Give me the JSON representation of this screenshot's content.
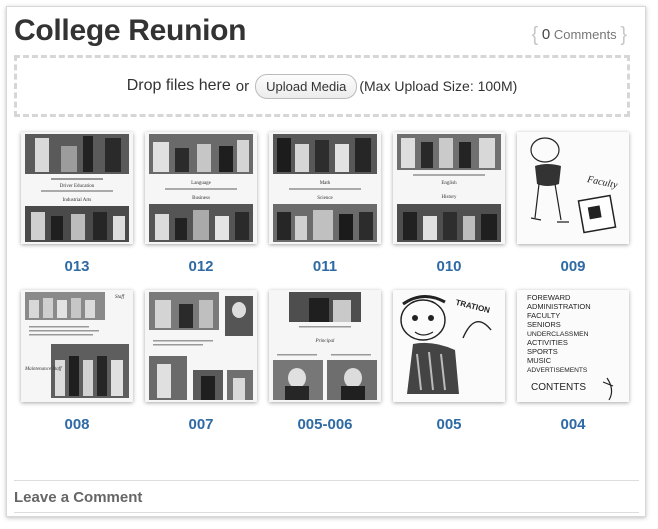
{
  "post": {
    "title": "College Reunion",
    "comments_count": "0",
    "comments_label": "Comments"
  },
  "upload": {
    "drop_text": "Drop files here",
    "or_text": "or",
    "button_label": "Upload Media",
    "max_size_text": "(Max Upload Size: 100M)"
  },
  "gallery": {
    "items": [
      {
        "caption": "013",
        "page_texts": [
          "Driver Education",
          "Industrial Arts"
        ]
      },
      {
        "caption": "012",
        "page_texts": [
          "Language",
          "Business"
        ]
      },
      {
        "caption": "011",
        "page_texts": [
          "Math",
          "Science"
        ]
      },
      {
        "caption": "010",
        "page_texts": [
          "English",
          "History"
        ]
      },
      {
        "caption": "009",
        "page_texts": [
          "Faculty"
        ]
      },
      {
        "caption": "008",
        "page_texts": [
          "Staff",
          "Maintenance Staff"
        ]
      },
      {
        "caption": "007",
        "page_texts": []
      },
      {
        "caption": "005-006",
        "page_texts": [
          "Principal"
        ]
      },
      {
        "caption": "005",
        "page_texts": [
          "TRATION"
        ]
      },
      {
        "caption": "004",
        "page_texts": [
          "FOREWARD",
          "ADMINISTRATION",
          "FACULTY",
          "SENIORS",
          "UNDERCLASSMEN",
          "ACTIVITIES",
          "SPORTS",
          "MUSIC",
          "ADVERTISEMENTS",
          "CONTENTS"
        ]
      }
    ]
  },
  "comments_section": {
    "heading": "Leave a Comment"
  }
}
